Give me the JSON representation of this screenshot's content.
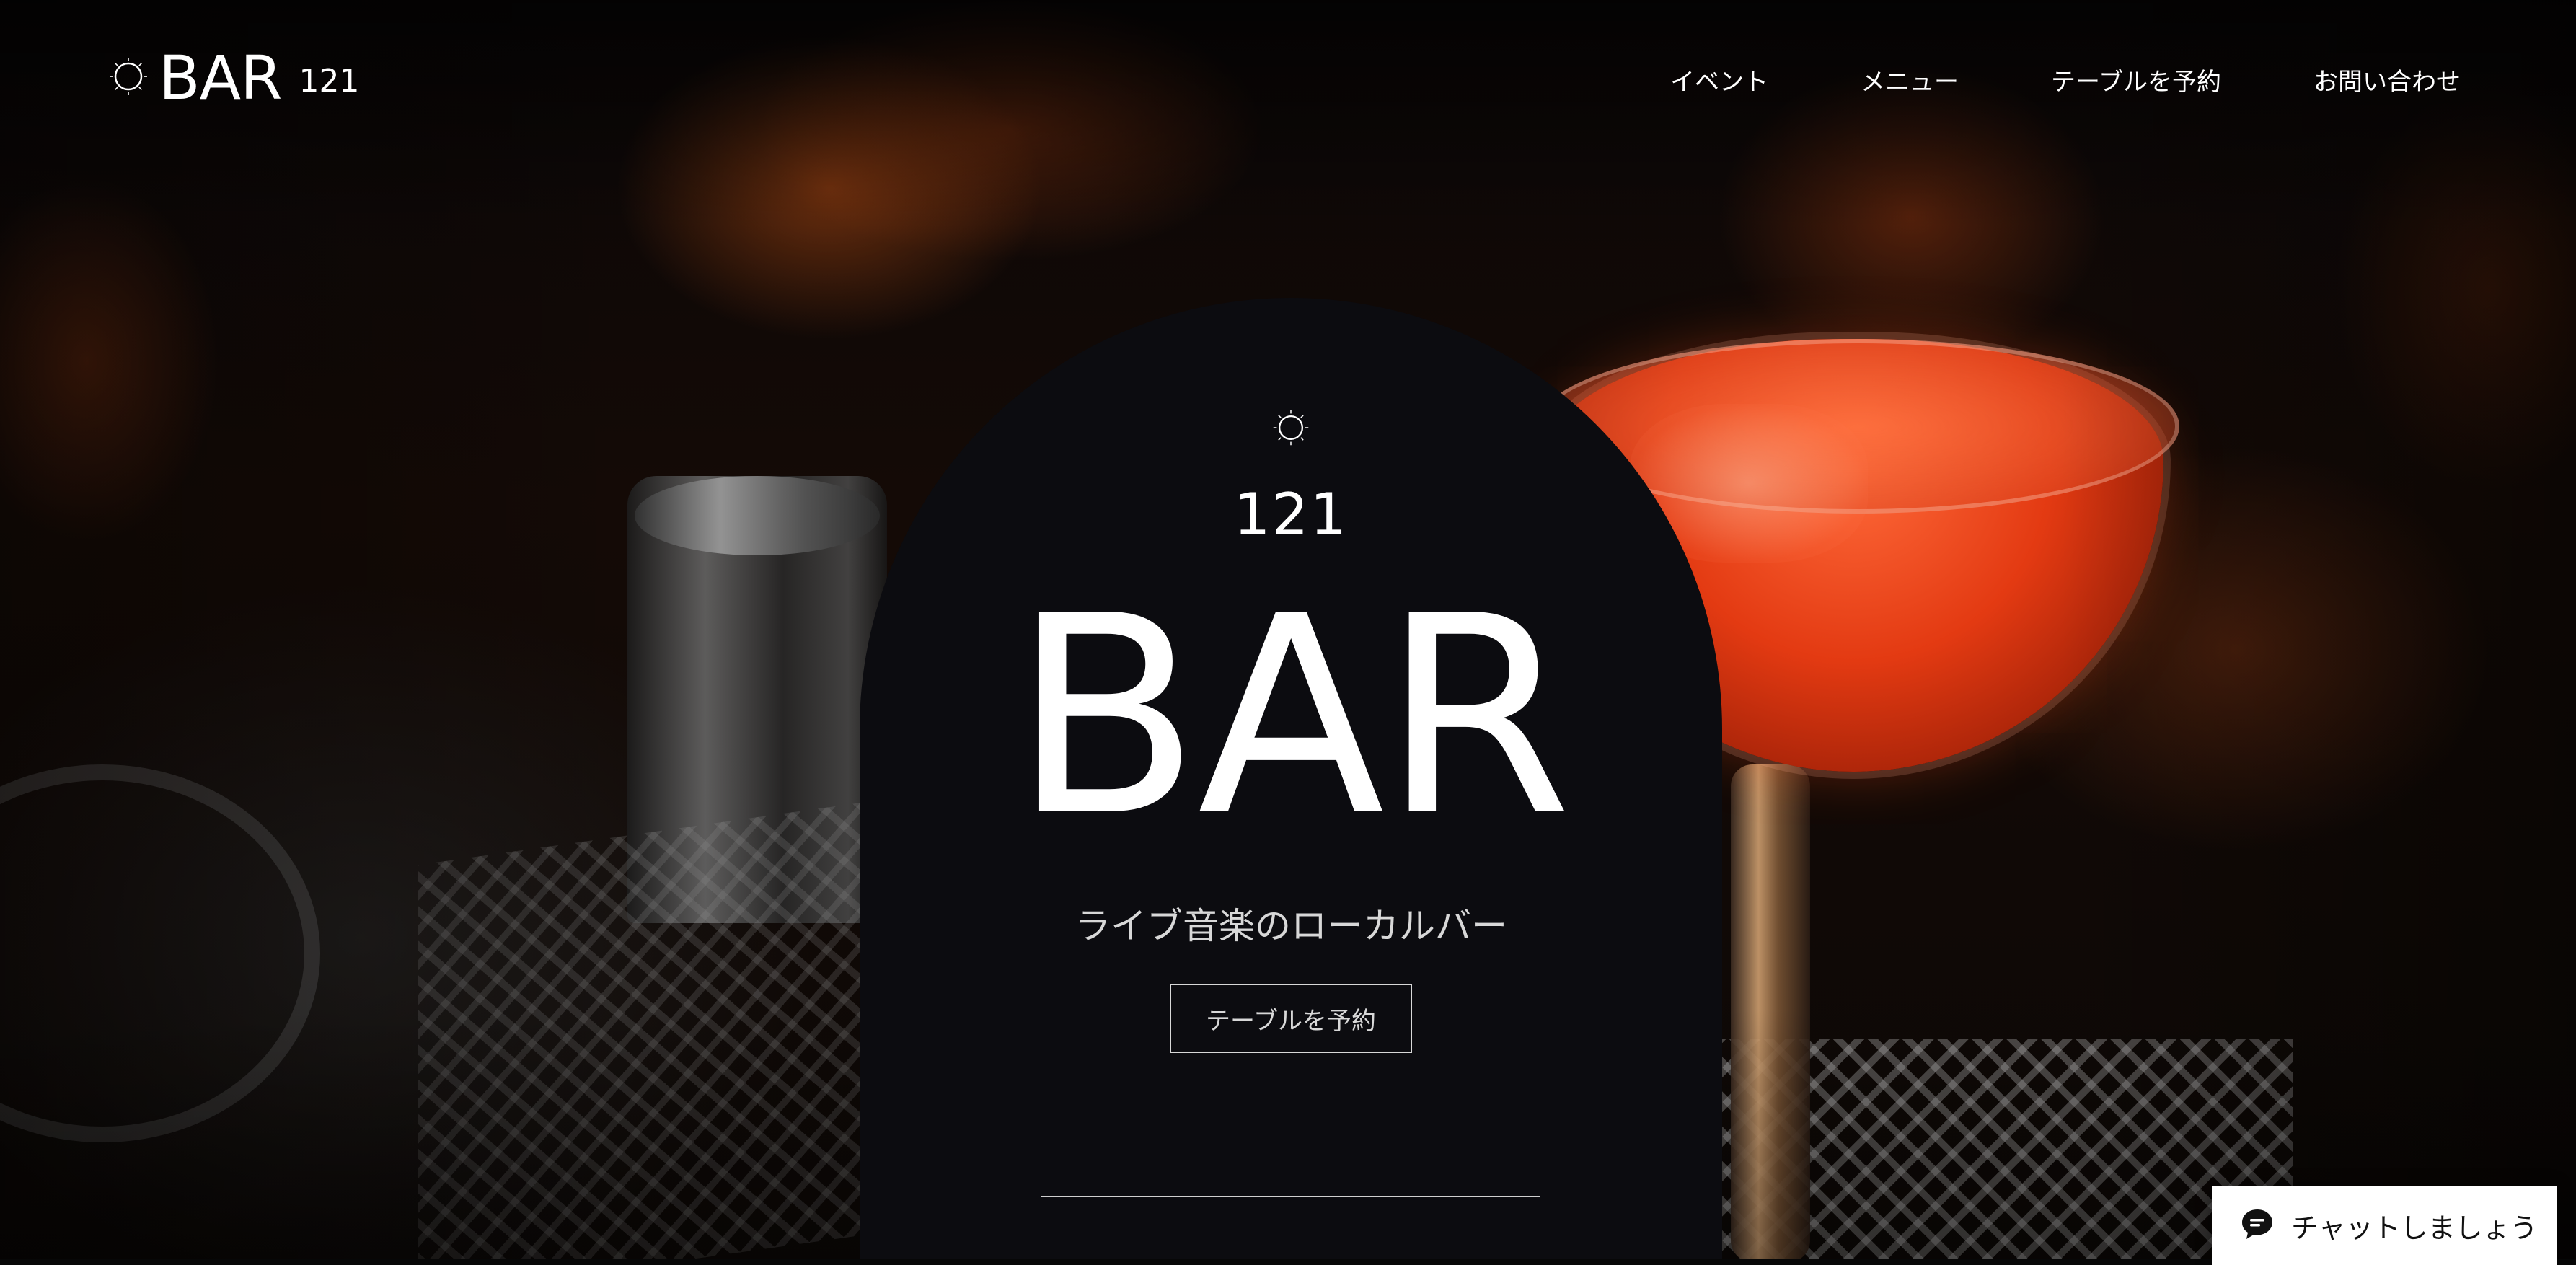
{
  "header": {
    "logo_text": "BAR",
    "logo_number": "121",
    "nav": [
      {
        "label": "イベント"
      },
      {
        "label": "メニュー"
      },
      {
        "label": "テーブルを予約"
      },
      {
        "label": "お問い合わせ"
      }
    ]
  },
  "hero": {
    "number": "121",
    "title": "BAR",
    "subtitle": "ライブ音楽のローカルバー",
    "cta_label": "テーブルを予約"
  },
  "chat": {
    "label": "チャットしましょう",
    "icon": "chat-bubble-icon"
  },
  "colors": {
    "arch_background": "#0c0c10",
    "text": "#ffffff",
    "chat_background": "#ffffff"
  }
}
